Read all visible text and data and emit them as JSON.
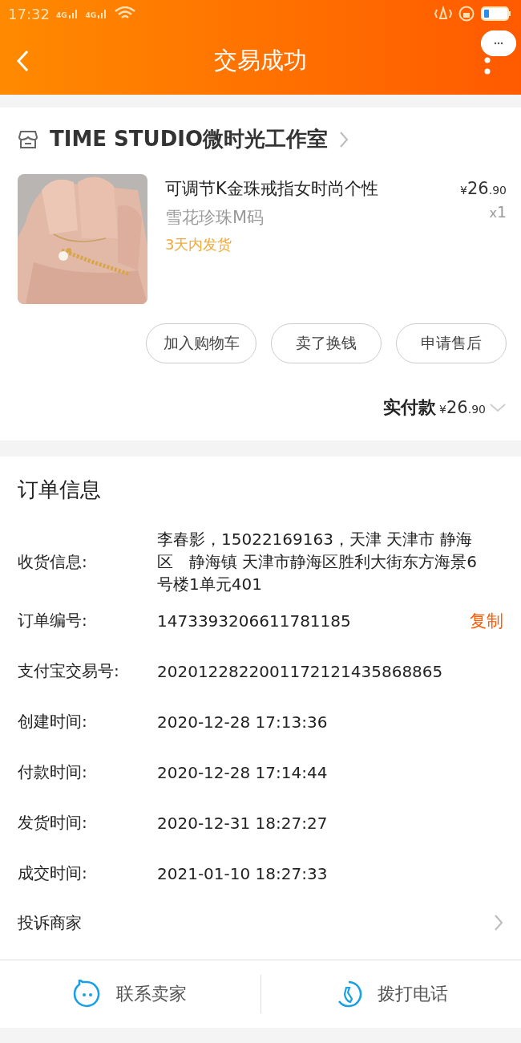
{
  "status_bar": {
    "time": "17:32",
    "network_1": "4G",
    "network_2": "4G"
  },
  "header": {
    "title": "交易成功"
  },
  "shop": {
    "name": "TIME STUDIO微时光工作室"
  },
  "item": {
    "title": "可调节K金珠戒指女时尚个性",
    "sku": "雪花珍珠M码",
    "shipping": "3天内发货",
    "currency": "¥",
    "price_int": "26",
    "price_dec": ".90",
    "qty_prefix": "x",
    "qty": "1"
  },
  "actions": [
    "加入购物车",
    "卖了换钱",
    "申请售后"
  ],
  "paid": {
    "label": "实付款",
    "currency": "¥",
    "amount_int": "26",
    "amount_dec": ".90"
  },
  "order_info": {
    "title": "订单信息",
    "rows": [
      {
        "label": "收货信息:",
        "value": "李春影，15022169163，天津 天津市 静海区　静海镇 天津市静海区胜利大街东方海景6号楼1单元401"
      },
      {
        "label": "订单编号:",
        "value": "1473393206611781185",
        "action": "复制"
      },
      {
        "label": "支付宝交易号:",
        "value": "2020122822001172121435868865"
      },
      {
        "label": "创建时间:",
        "value": "2020-12-28 17:13:36"
      },
      {
        "label": "付款时间:",
        "value": "2020-12-28 17:14:44"
      },
      {
        "label": "发货时间:",
        "value": "2020-12-31 18:27:27"
      },
      {
        "label": "成交时间:",
        "value": "2021-01-10 18:27:33"
      }
    ],
    "complaint": "投诉商家"
  },
  "bottom_bar": [
    {
      "kind": "chat",
      "label": "联系卖家"
    },
    {
      "kind": "phone",
      "label": "拨打电话"
    }
  ]
}
